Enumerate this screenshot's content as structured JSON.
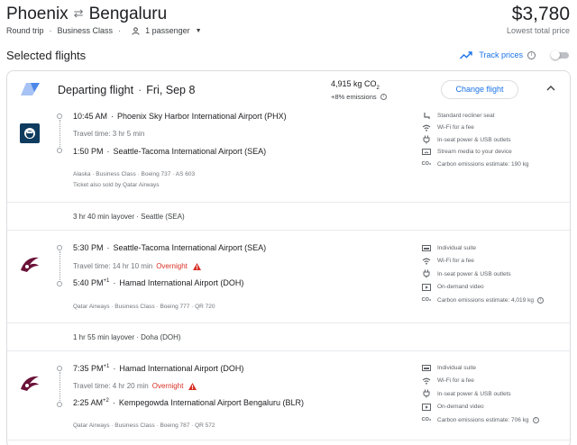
{
  "header": {
    "origin": "Phoenix",
    "destination": "Bengaluru",
    "trip_type": "Round trip",
    "cabin": "Business Class",
    "passengers": "1 passenger",
    "price": "$3,780",
    "price_note": "Lowest total price"
  },
  "selected": {
    "heading": "Selected flights",
    "track_label": "Track prices",
    "track_on": false
  },
  "card": {
    "title": "Departing flight",
    "date": "Fri, Sep 8",
    "co2_value": "4,915 kg CO",
    "co2_sub": "2",
    "emissions": "+8% emissions",
    "change_label": "Change flight"
  },
  "segments": [
    {
      "dep_time": "10:45 AM",
      "dep_sup": "",
      "dep_airport": "Phoenix Sky Harbor International Airport (PHX)",
      "travel": "Travel time: 3 hr 5 min",
      "overnight": "",
      "arr_time": "1:50 PM",
      "arr_sup": "",
      "arr_airport": "Seattle-Tacoma International Airport (SEA)",
      "details": "Alaska · Business Class · Boeing 737 · AS 603",
      "sold_by": "Ticket also sold by Qatar Airways",
      "amenities": [
        {
          "icon": "seat-icon",
          "text": "Standard recliner seat"
        },
        {
          "icon": "wifi-icon",
          "text": "Wi-Fi for a fee"
        },
        {
          "icon": "power-icon",
          "text": "In-seat power & USB outlets"
        },
        {
          "icon": "stream-icon",
          "text": "Stream media to your device"
        },
        {
          "icon": "co2-icon",
          "text": "Carbon emissions estimate: 190 kg"
        }
      ]
    },
    {
      "dep_time": "5:30 PM",
      "dep_sup": "",
      "dep_airport": "Seattle-Tacoma International Airport (SEA)",
      "travel": "Travel time: 14 hr 10 min",
      "overnight": "Overnight",
      "arr_time": "5:40 PM",
      "arr_sup": "+1",
      "arr_airport": "Hamad International Airport (DOH)",
      "details": "Qatar Airways · Business Class · Boeing 777 · QR 720",
      "sold_by": "",
      "amenities": [
        {
          "icon": "suite-icon",
          "text": "Individual suite"
        },
        {
          "icon": "wifi-icon",
          "text": "Wi-Fi for a fee"
        },
        {
          "icon": "power-icon",
          "text": "In-seat power & USB outlets"
        },
        {
          "icon": "video-icon",
          "text": "On-demand video"
        },
        {
          "icon": "co2-icon",
          "text": "Carbon emissions estimate: 4,019 kg"
        }
      ]
    },
    {
      "dep_time": "7:35 PM",
      "dep_sup": "+1",
      "dep_airport": "Hamad International Airport (DOH)",
      "travel": "Travel time: 4 hr 20 min",
      "overnight": "Overnight",
      "arr_time": "2:25 AM",
      "arr_sup": "+2",
      "arr_airport": "Kempegowda International Airport Bengaluru (BLR)",
      "details": "Qatar Airways · Business Class · Boeing 787 · QR 572",
      "sold_by": "",
      "amenities": [
        {
          "icon": "suite-icon",
          "text": "Individual suite"
        },
        {
          "icon": "wifi-icon",
          "text": "Wi-Fi for a fee"
        },
        {
          "icon": "power-icon",
          "text": "In-seat power & USB outlets"
        },
        {
          "icon": "video-icon",
          "text": "On-demand video"
        },
        {
          "icon": "co2-icon",
          "text": "Carbon emissions estimate: 706 kg"
        }
      ]
    }
  ],
  "layovers": [
    "3 hr 40 min layover · Seattle (SEA)",
    "1 hr 55 min layover · Doha (DOH)"
  ]
}
